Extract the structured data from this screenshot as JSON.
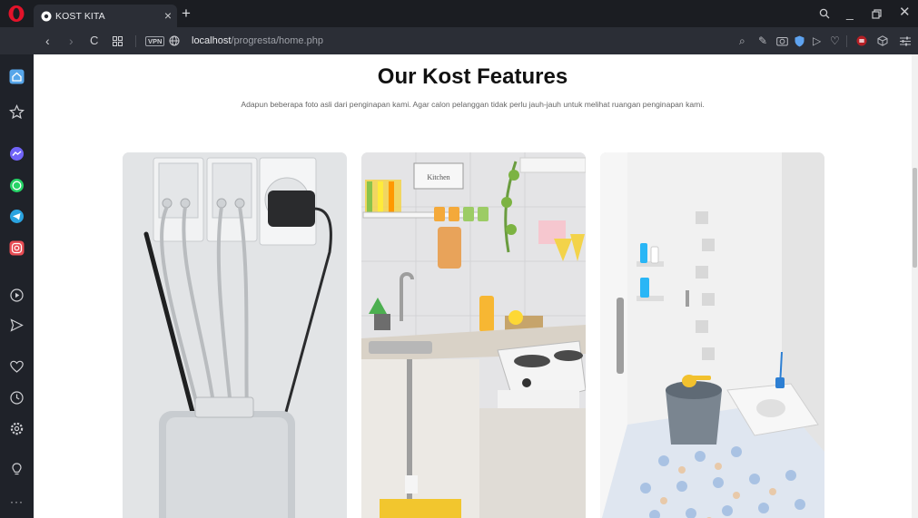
{
  "browser": {
    "tab": {
      "title": "KOST KITA"
    },
    "vpn_label": "VPN",
    "url": {
      "host": "localhost",
      "path": "/progresta/home.php"
    }
  },
  "page": {
    "title": "Our Kost Features",
    "description": "Adapun beberapa foto asli dari penginapan kami. Agar calon pelanggan tidak perlu jauh-jauh untuk melihat ruangan penginapan kami."
  },
  "gallery": {
    "photos": [
      {
        "subject": "charger-power-strip-photo"
      },
      {
        "subject": "kitchen-photo",
        "sign_text": "Kitchen"
      },
      {
        "subject": "bathroom-photo"
      }
    ]
  }
}
